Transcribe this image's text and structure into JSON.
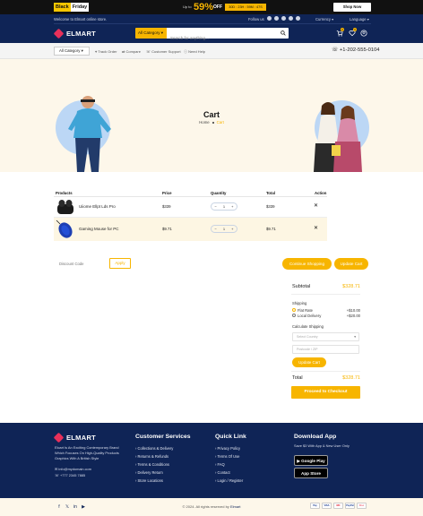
{
  "promo": {
    "badge_left": "Black",
    "badge_right": "Friday",
    "upto": "Up to",
    "percent": "59%",
    "off": "OFF",
    "timer": "30D : 23H : 59M : 47S",
    "shop_now": "Shop Now"
  },
  "header": {
    "welcome": "Welcome to Elmart online store.",
    "follow": "Follow us",
    "currency": "Currency",
    "language": "Language",
    "logo": "ELMART",
    "category": "All Category",
    "search_placeholder": "Search for anything...",
    "cart_count": "0",
    "wishlist_count": "0"
  },
  "nav": {
    "all_category": "All Category",
    "links": [
      "Track Order",
      "Compare",
      "Customer Support",
      "Need Help"
    ],
    "phone": "+1-202-555-0104"
  },
  "hero": {
    "title": "Cart",
    "breadcrumb_home": "Home",
    "breadcrumb_current": "Cart"
  },
  "cart": {
    "headers": [
      "Products",
      "Price",
      "Quantity",
      "Total",
      "Action"
    ],
    "rows": [
      {
        "name": "Uiiome Ellpt Lds Pro",
        "price": "$339",
        "qty": "1",
        "total": "$339"
      },
      {
        "name": "Gaming Mouse for PC",
        "price": "$9.71",
        "qty": "1",
        "total": "$9.71"
      }
    ],
    "coupon_placeholder": "Discount Code",
    "apply": "Apply",
    "continue": "Continue Shopping",
    "update": "Update Cart"
  },
  "totals": {
    "subtotal_label": "Subtotal",
    "subtotal_value": "$328.71",
    "shipping_label": "Shipping",
    "ship1_label": "Flat Rate",
    "ship1_value": "+$10.00",
    "ship2_label": "Local Delivery",
    "ship2_value": "+$20.00",
    "calc_label": "Calculate Shipping",
    "country_placeholder": "Select Country",
    "postcode_placeholder": "Postcode / ZIP",
    "update_cart": "Update Cart",
    "total_label": "Total",
    "total_value": "$328.71",
    "checkout": "Proceed to Checkout"
  },
  "footer": {
    "logo": "ELMART",
    "about": "Elcart Is An Exciting Contemporary Brand Which Focuses On High-Quality Products Graphics With A British Style",
    "email": "info@mydomain.com",
    "phone": "+777 2345 7885",
    "cs_title": "Customer Services",
    "cs_links": [
      "Collections & Delivery",
      "Returns & Refunds",
      "Terms & Conditions",
      "Delivery Return",
      "Store Locations"
    ],
    "ql_title": "Quick Link",
    "ql_links": [
      "Privacy Policy",
      "Terms Of Use",
      "FAQ",
      "Contact",
      "Login / Register"
    ],
    "app_title": "Download App",
    "app_text": "Save $3 With App & New User Only",
    "google": "Google Play",
    "apple": "App Store",
    "copyright": "© 2024. All rights reserved by",
    "copyright_brand": "Elmart",
    "payments": [
      "Pay",
      "VISA",
      "MC",
      "PayPal",
      "Disc"
    ]
  },
  "colors": {
    "navy": "#0f2456",
    "accent": "#f7b500",
    "hero_bg": "#fdf7ea"
  }
}
